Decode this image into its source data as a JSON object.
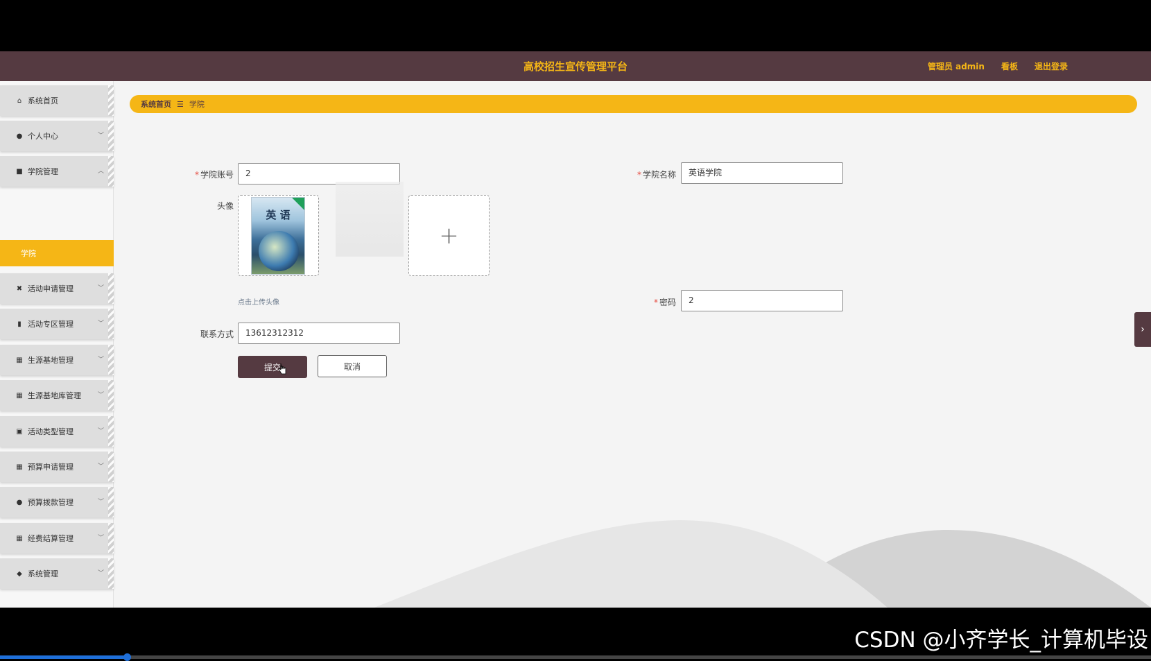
{
  "header": {
    "title": "高校招生宣传管理平台",
    "admin_label": "管理员 admin",
    "board_label": "看板",
    "logout_label": "退出登录"
  },
  "sidebar": {
    "items": [
      {
        "label": "系统首页",
        "icon": "home-icon"
      },
      {
        "label": "个人中心",
        "icon": "user-icon"
      },
      {
        "label": "学院管理",
        "icon": "briefcase-icon"
      },
      {
        "label": "活动申请管理",
        "icon": "ticket-icon"
      },
      {
        "label": "活动专区管理",
        "icon": "chart-icon"
      },
      {
        "label": "生源基地管理",
        "icon": "grid-icon"
      },
      {
        "label": "生源基地库管理",
        "icon": "grid-icon"
      },
      {
        "label": "活动类型管理",
        "icon": "clipboard-icon"
      },
      {
        "label": "预算申请管理",
        "icon": "grid-icon"
      },
      {
        "label": "预算拨款管理",
        "icon": "person-icon"
      },
      {
        "label": "经费结算管理",
        "icon": "grid-icon"
      },
      {
        "label": "系统管理",
        "icon": "pin-icon"
      }
    ],
    "active_sub": "学院"
  },
  "breadcrumb": {
    "home": "系统首页",
    "separator": "☰",
    "current": "学院"
  },
  "form": {
    "account_label": "学院账号",
    "account_value": "2",
    "name_label": "学院名称",
    "name_value": "英语学院",
    "avatar_label": "头像",
    "upload_hint": "点击上传头像",
    "book_title": "英 语",
    "password_label": "密码",
    "password_value": "2",
    "phone_label": "联系方式",
    "phone_value": "13612312312",
    "submit_label": "提交",
    "cancel_label": "取消"
  },
  "watermark": "CSDN @小齐学长_计算机毕设",
  "video_progress": 0.11,
  "colors": {
    "header_bg": "#553a41",
    "accent": "#f5b616",
    "required": "#e54d42"
  }
}
